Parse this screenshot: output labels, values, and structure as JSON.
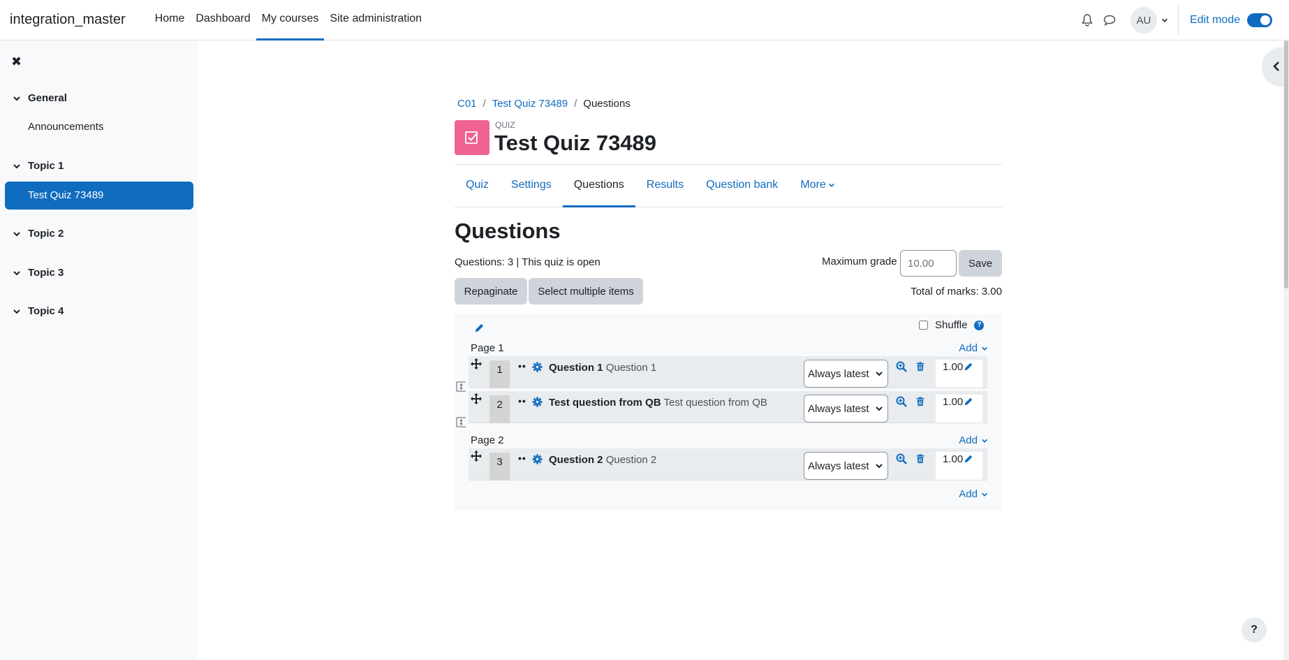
{
  "navbar": {
    "brand": "integration_master",
    "links": [
      {
        "label": "Home",
        "active": false
      },
      {
        "label": "Dashboard",
        "active": false
      },
      {
        "label": "My courses",
        "active": true
      },
      {
        "label": "Site administration",
        "active": false
      }
    ],
    "icons": [
      "bell-icon",
      "chat-icon"
    ],
    "avatar_initials": "AU",
    "edit_mode_label": "Edit mode",
    "edit_mode_on": true
  },
  "drawer": {
    "sections": [
      {
        "label": "General",
        "items": [
          "Announcements"
        ]
      },
      {
        "label": "Topic 1",
        "items": [
          "Test Quiz 73489"
        ]
      },
      {
        "label": "Topic 2",
        "items": []
      },
      {
        "label": "Topic 3",
        "items": []
      },
      {
        "label": "Topic 4",
        "items": []
      }
    ],
    "active_item": "Test Quiz 73489"
  },
  "breadcrumb": [
    "C01",
    "Test Quiz 73489",
    "Questions"
  ],
  "header": {
    "module_type": "QUIZ",
    "title": "Test Quiz 73489"
  },
  "tabs": [
    "Quiz",
    "Settings",
    "Questions",
    "Results",
    "Question bank",
    "More"
  ],
  "active_tab": "Questions",
  "page": {
    "heading": "Questions",
    "info": "Questions: 3 | This quiz is open",
    "max_grade_label": "Maximum grade",
    "max_grade_value": "10.00",
    "save_label": "Save",
    "repaginate_label": "Repaginate",
    "select_multiple_label": "Select multiple items",
    "total_marks": "Total of marks: 3.00",
    "shuffle_label": "Shuffle",
    "add_label": "Add"
  },
  "pages": [
    {
      "label": "Page 1",
      "questions": [
        {
          "number": "1",
          "name": "Question 1",
          "text": "Question 1",
          "version": "Always latest",
          "mark": "1.00"
        },
        {
          "number": "2",
          "name": "Test question from QB",
          "text": "Test question from QB",
          "version": "Always latest",
          "mark": "1.00"
        }
      ]
    },
    {
      "label": "Page 2",
      "questions": [
        {
          "number": "3",
          "name": "Question 2",
          "text": "Question 2",
          "version": "Always latest",
          "mark": "1.00"
        }
      ]
    }
  ],
  "colors": {
    "primary": "#0f6cbf",
    "quiz_icon": "#f06292",
    "drawer_bg": "#f8f9fa"
  },
  "help_button": "?"
}
